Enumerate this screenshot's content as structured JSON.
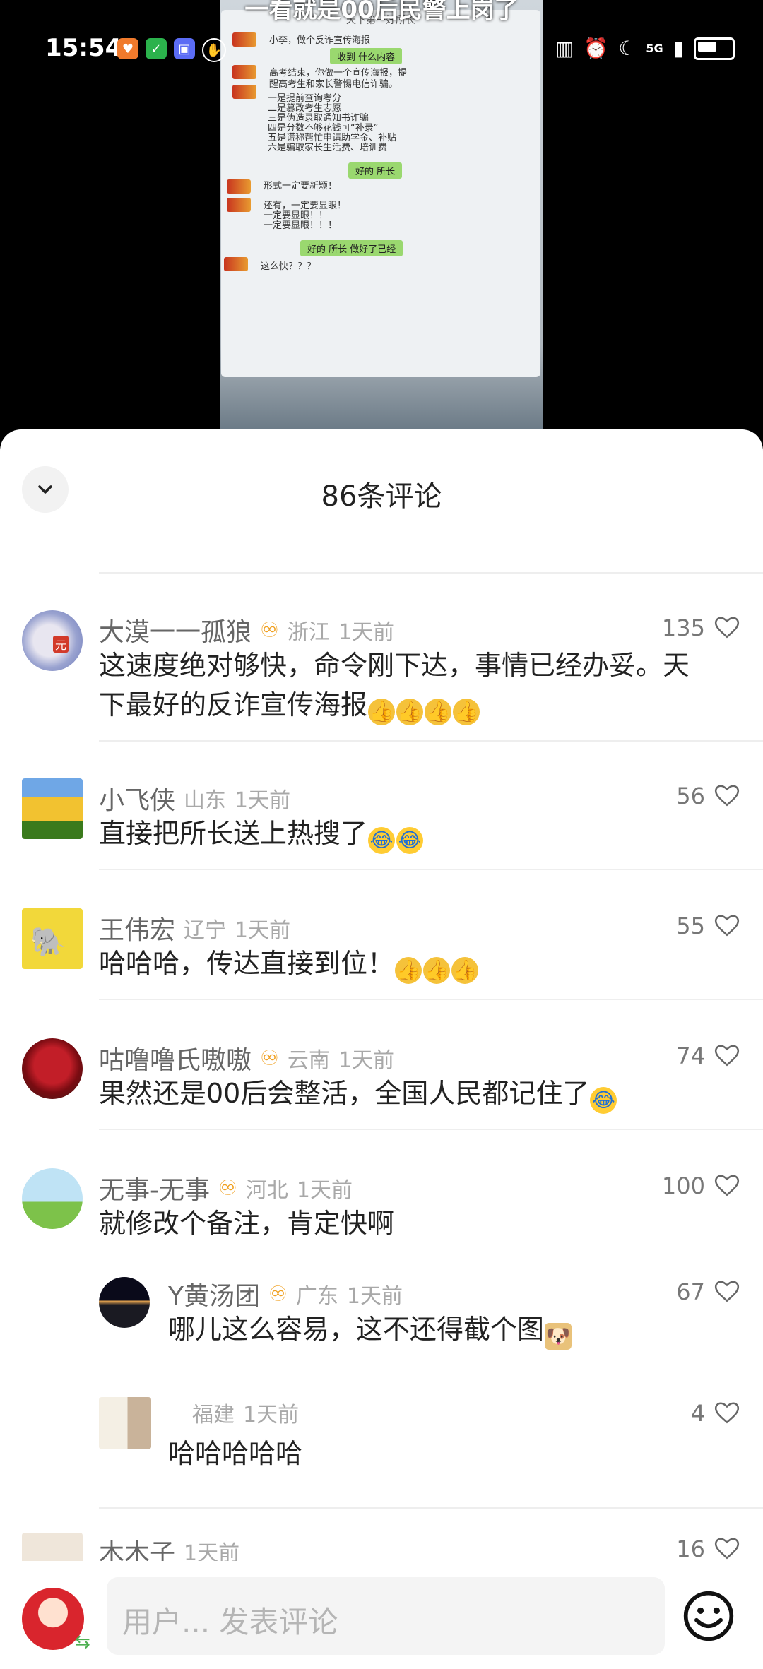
{
  "status_bar": {
    "time": "15:54",
    "network": "5G"
  },
  "video": {
    "caption": "一看就是00后民警上岗了",
    "chat_title": "天下第一好所长",
    "lines": [
      "小李，做个反诈宣传海报",
      "收到 什么内容",
      "高考结束，你做一个宣传海报，提",
      "醒高考生和家长警惕电信诈骗。",
      "一是提前查询考分",
      "二是篡改考生志愿",
      "三是伪造录取通知书诈骗",
      "四是分数不够花钱可“补录”",
      "五是谎称帮忙申请助学金、补贴",
      "六是骗取家长生活费、培训费",
      "好的 所长",
      "形式一定要新颖！",
      "还有，一定要显眼！",
      "一定要显眼！！",
      "一定要显眼！！！",
      "好的 所长 做好了已经",
      "这么快？？？"
    ]
  },
  "sheet": {
    "title": "86条评论"
  },
  "comments": [
    {
      "name": "大漠一一孤狼",
      "location": "浙江",
      "time": "1天前",
      "likes": "135",
      "text_1": "这速度绝对够快，命令刚下达，事情已经办妥。天",
      "text_2": "下最好的反诈宣传海报",
      "avatar_text": "元"
    },
    {
      "name": "小飞侠",
      "location": "山东",
      "time": "1天前",
      "likes": "56",
      "text_1": "直接把所长送上热搜了"
    },
    {
      "name": "王伟宏",
      "location": "辽宁",
      "time": "1天前",
      "likes": "55",
      "text_1": "哈哈哈，传达直接到位！"
    },
    {
      "name": "咕噜噜氏嗷嗷",
      "location": "云南",
      "time": "1天前",
      "likes": "74",
      "text_1": "果然还是00后会整活，全国人民都记住了"
    },
    {
      "name": "无事-无事",
      "location": "河北",
      "time": "1天前",
      "likes": "100",
      "text_1": "就修改个备注，肯定快啊"
    },
    {
      "name": "木木子",
      "location": "",
      "time": "1天前",
      "likes": "16"
    }
  ],
  "replies": [
    {
      "name": "Y黄汤团",
      "location": "广东",
      "time": "1天前",
      "likes": "67",
      "text": "哪儿这么容易，这不还得截个图"
    },
    {
      "name": "",
      "location": "福建",
      "time": "1天前",
      "likes": "4",
      "text": "哈哈哈哈哈"
    }
  ],
  "input": {
    "placeholder": "用户... 发表评论"
  },
  "colors": {
    "vip": "#f0a020",
    "name": "#666666",
    "meta": "#a8a8a8"
  }
}
